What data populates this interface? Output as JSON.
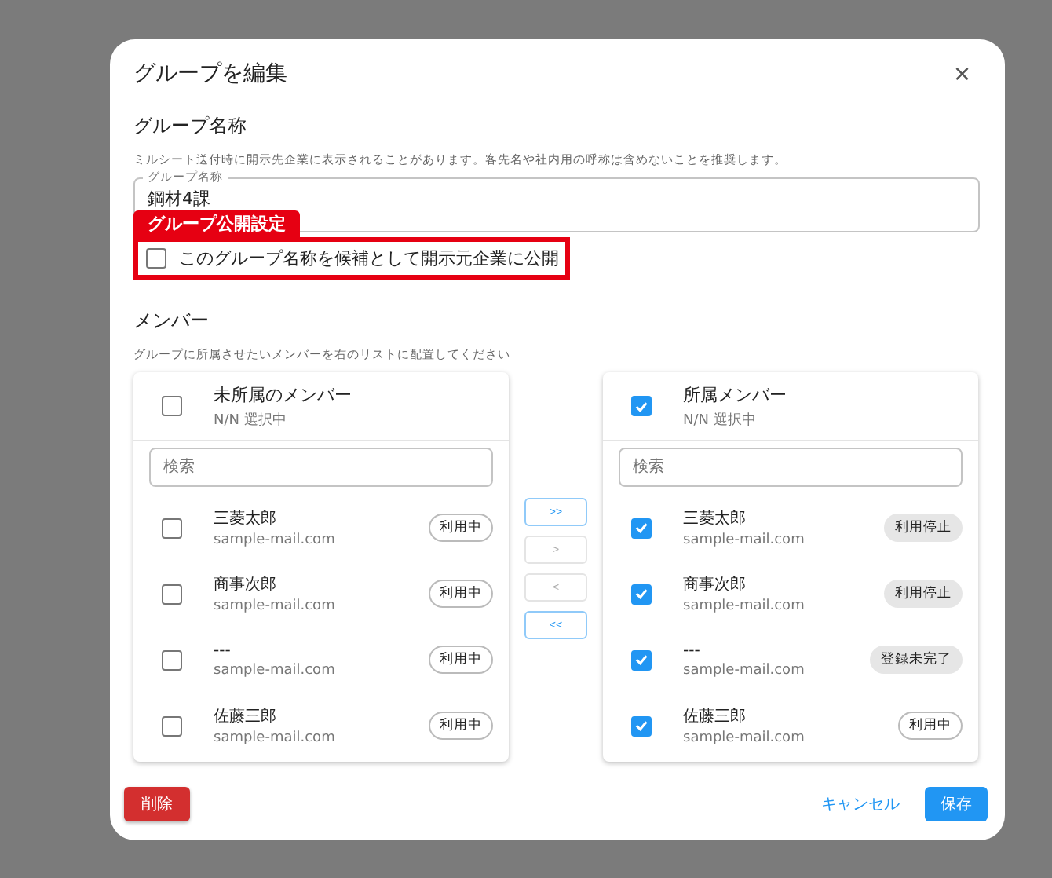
{
  "dialog": {
    "title": "グループを編集",
    "close_label": "×"
  },
  "group_name": {
    "heading": "グループ名称",
    "help": "ミルシート送付時に開示先企業に表示されることがあります。客先名や社内用の呼称は含めないことを推奨します。",
    "field_label": "グループ名称",
    "value": "鋼材4課"
  },
  "annotation": {
    "label": "グループ公開設定"
  },
  "publish_option": {
    "label": "このグループ名称を候補として開示元企業に公開",
    "checked": false
  },
  "members": {
    "heading": "メンバー",
    "help": "グループに所属させたいメンバーを右のリストに配置してください",
    "lists": [
      {
        "title": "未所属のメンバー",
        "count": "N/N 選択中",
        "checked": false,
        "search_placeholder": "検索",
        "items": [
          {
            "name": "三菱太郎",
            "email": "sample-mail.com",
            "checked": false,
            "status": "利用中",
            "kind": "outlined"
          },
          {
            "name": "商事次郎",
            "email": "sample-mail.com",
            "checked": false,
            "status": "利用中",
            "kind": "outlined"
          },
          {
            "name": "---",
            "email": "sample-mail.com",
            "checked": false,
            "status": "利用中",
            "kind": "outlined"
          },
          {
            "name": "佐藤三郎",
            "email": "sample-mail.com",
            "checked": false,
            "status": "利用中",
            "kind": "outlined"
          }
        ]
      },
      {
        "title": "所属メンバー",
        "count": "N/N 選択中",
        "checked": true,
        "search_placeholder": "検索",
        "items": [
          {
            "name": "三菱太郎",
            "email": "sample-mail.com",
            "checked": true,
            "status": "利用停止",
            "kind": "filled"
          },
          {
            "name": "商事次郎",
            "email": "sample-mail.com",
            "checked": true,
            "status": "利用停止",
            "kind": "filled"
          },
          {
            "name": "---",
            "email": "sample-mail.com",
            "checked": true,
            "status": "登録未完了",
            "kind": "filled"
          },
          {
            "name": "佐藤三郎",
            "email": "sample-mail.com",
            "checked": true,
            "status": "利用中",
            "kind": "outlined"
          }
        ]
      }
    ],
    "transfer_buttons": [
      {
        "label": ">>",
        "disabled": false
      },
      {
        "label": ">",
        "disabled": true
      },
      {
        "label": "<",
        "disabled": true
      },
      {
        "label": "<<",
        "disabled": false
      }
    ]
  },
  "buttons": {
    "delete": "削除",
    "cancel": "キャンセル",
    "save": "保存"
  }
}
